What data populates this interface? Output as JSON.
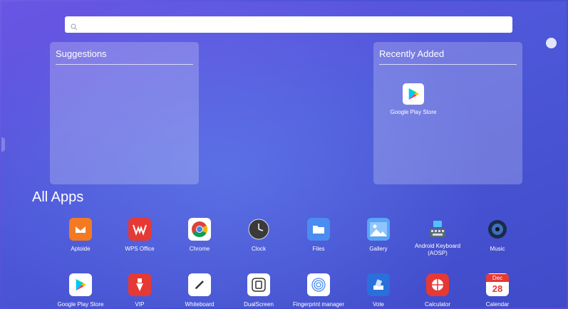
{
  "search": {
    "placeholder": ""
  },
  "suggestions": {
    "title": "Suggestions"
  },
  "recently_added": {
    "title": "Recently Added",
    "items": [
      {
        "label": "Google Play Store",
        "icon": "play-store-icon"
      }
    ]
  },
  "all_apps": {
    "title": "All Apps",
    "row1": [
      {
        "label": "Aptoide",
        "icon": "aptoide-icon",
        "color": "#f37a22"
      },
      {
        "label": "WPS Office",
        "icon": "wps-office-icon",
        "color": "#e53935"
      },
      {
        "label": "Chrome",
        "icon": "chrome-icon",
        "color": "#ffffff"
      },
      {
        "label": "Clock",
        "icon": "clock-icon",
        "color": "#3a3a3a"
      },
      {
        "label": "Files",
        "icon": "files-icon",
        "color": "#4a8cf0"
      },
      {
        "label": "Gallery",
        "icon": "gallery-icon",
        "color": "#5aa4f5"
      },
      {
        "label": "Android Keyboard (AOSP)",
        "icon": "keyboard-icon",
        "color": "#5b6b7a"
      },
      {
        "label": "Music",
        "icon": "music-icon",
        "color": "#1b2a4a"
      }
    ],
    "row2": [
      {
        "label": "Google Play Store",
        "icon": "play-store-icon",
        "color": "#ffffff"
      },
      {
        "label": "VIP",
        "icon": "vip-icon",
        "color": "#e53935"
      },
      {
        "label": "Whiteboard",
        "icon": "whiteboard-icon",
        "color": "#ffffff"
      },
      {
        "label": "DualScreen",
        "icon": "dualscreen-icon",
        "color": "#ffffff"
      },
      {
        "label": "Fingerprint manager",
        "icon": "fingerprint-icon",
        "color": "#ffffff"
      },
      {
        "label": "Vote",
        "icon": "vote-icon",
        "color": "#2a6fdb"
      },
      {
        "label": "Calculator",
        "icon": "calculator-icon",
        "color": "#e53935"
      },
      {
        "label": "Calendar",
        "icon": "calendar-icon",
        "color": "#ffffff",
        "month": "Dec",
        "day": "28"
      }
    ]
  }
}
